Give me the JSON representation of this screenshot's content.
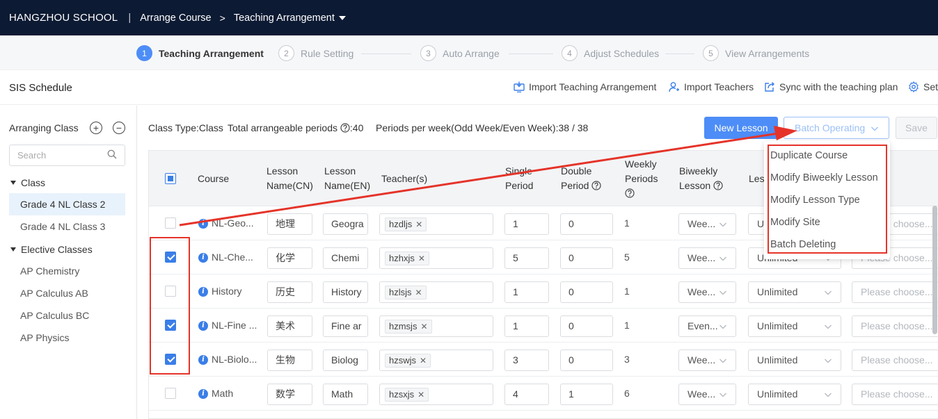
{
  "topbar": {
    "school": "HANGZHOU SCHOOL",
    "separator": "|",
    "crumb1": "Arrange Course",
    "chevron": ">",
    "crumb2": "Teaching Arrangement"
  },
  "steps": [
    {
      "num": "1",
      "label": "Teaching Arrangement"
    },
    {
      "num": "2",
      "label": "Rule Setting"
    },
    {
      "num": "3",
      "label": "Auto Arrange"
    },
    {
      "num": "4",
      "label": "Adjust Schedules"
    },
    {
      "num": "5",
      "label": "View Arrangements"
    }
  ],
  "header": {
    "title": "SIS Schedule",
    "import_arrangement": "Import Teaching Arrangement",
    "import_teachers": "Import Teachers",
    "sync": "Sync with the teaching plan",
    "settings": "Set"
  },
  "sidebar": {
    "title": "Arranging Class",
    "add": "+",
    "remove": "−",
    "search_placeholder": "Search",
    "group_class": "Class",
    "class_items": [
      "Grade 4 NL Class 2",
      "Grade 4 NL Class 3"
    ],
    "group_elective": "Elective Classes",
    "elective_items": [
      "AP Chemistry",
      "AP Calculus AB",
      "AP Calculus BC",
      "AP Physics"
    ]
  },
  "info": {
    "class_type": "Class Type:Class",
    "total_label": "Total arrangeable periods",
    "total_value": ":40",
    "periods_week": "Periods per week(Odd Week/Even Week):38 / 38"
  },
  "buttons": {
    "new_lesson": "New Lesson",
    "batch_operating": "Batch Operating",
    "save": "Save"
  },
  "table": {
    "headers": {
      "course": "Course",
      "lesson_cn_1": "Lesson",
      "lesson_cn_2": "Name(CN)",
      "lesson_en_1": "Lesson",
      "lesson_en_2": "Name(EN)",
      "teachers": "Teacher(s)",
      "single_1": "Single",
      "single_2": "Period",
      "double_1": "Double",
      "double_2": "Period",
      "weekly_1": "Weekly",
      "weekly_2": "Periods",
      "biweekly_1": "Biweekly",
      "biweekly_2": "Lesson",
      "less": "Les"
    },
    "rows": [
      {
        "checked": false,
        "course": "NL-Geo...",
        "cn": "地理",
        "en": "Geogra",
        "teacher": "hzdljs",
        "single": "1",
        "double": "0",
        "weekly": "1",
        "biweekly": "Wee...",
        "limit": "Unlimited",
        "site": "Please choose..."
      },
      {
        "checked": true,
        "course": "NL-Che...",
        "cn": "化学",
        "en": "Chemi",
        "teacher": "hzhxjs",
        "single": "5",
        "double": "0",
        "weekly": "5",
        "biweekly": "Wee...",
        "limit": "Unlimited",
        "site": "Please choose..."
      },
      {
        "checked": false,
        "course": "History",
        "cn": "历史",
        "en": "History",
        "teacher": "hzlsjs",
        "single": "1",
        "double": "0",
        "weekly": "1",
        "biweekly": "Wee...",
        "limit": "Unlimited",
        "site": "Please choose..."
      },
      {
        "checked": true,
        "course": "NL-Fine ...",
        "cn": "美术",
        "en": "Fine ar",
        "teacher": "hzmsjs",
        "single": "1",
        "double": "0",
        "weekly": "1",
        "biweekly": "Even...",
        "limit": "Unlimited",
        "site": "Please choose..."
      },
      {
        "checked": true,
        "course": "NL-Biolo...",
        "cn": "生物",
        "en": "Biolog",
        "teacher": "hzswjs",
        "single": "3",
        "double": "0",
        "weekly": "3",
        "biweekly": "Wee...",
        "limit": "Unlimited",
        "site": "Please choose..."
      },
      {
        "checked": false,
        "course": "Math",
        "cn": "数学",
        "en": "Math",
        "teacher": "hzsxjs",
        "single": "4",
        "double": "1",
        "weekly": "6",
        "biweekly": "Wee...",
        "limit": "Unlimited",
        "site": "Please choose..."
      }
    ]
  },
  "menu": {
    "items": [
      "Duplicate Course",
      "Modify Biweekly Lesson",
      "Modify Lesson Type",
      "Modify Site",
      "Batch Deleting"
    ]
  },
  "colors": {
    "topbar": "#0c1a33",
    "primary": "#4d8df7",
    "annotation": "#e53329"
  }
}
